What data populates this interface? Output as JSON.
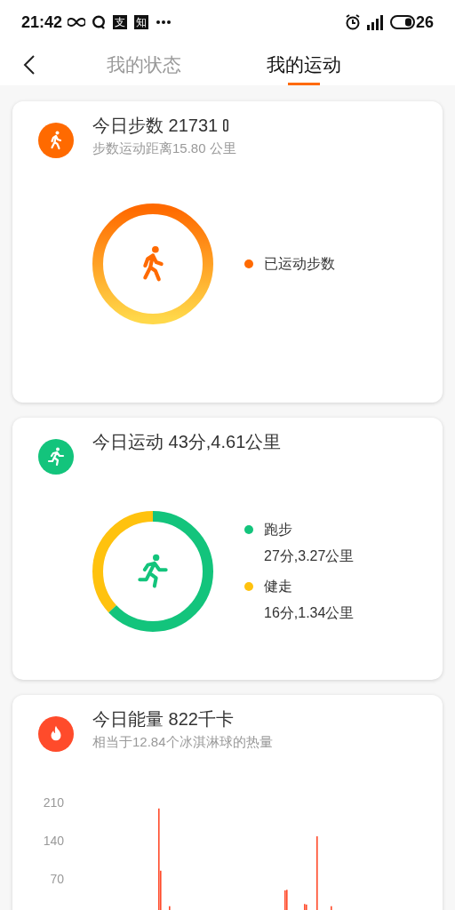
{
  "status_bar": {
    "time": "21:42",
    "app_labels": [
      "支",
      "知"
    ],
    "battery": "26"
  },
  "tabs": [
    {
      "label": "我的状态",
      "selected": false
    },
    {
      "label": "我的运动",
      "selected": true
    }
  ],
  "cards": [
    {
      "kind": "steps",
      "color": "#ff6a00",
      "title": "今日步数 21731",
      "subtitle": "步数运动距离15.80 公里",
      "legend": [
        {
          "label": "已运动步数",
          "color": "#ff6a00"
        }
      ]
    },
    {
      "kind": "activity",
      "color": "#13c47c",
      "title": "今日运动 43分,4.61公里",
      "segments": [
        {
          "label": "跑步",
          "detail": "27分,3.27公里",
          "color": "#13c47c"
        },
        {
          "label": "健走",
          "detail": "16分,1.34公里",
          "color": "#ffc20e"
        }
      ]
    },
    {
      "kind": "energy",
      "color": "#ff4b2b",
      "title": "今日能量 822千卡",
      "subtitle": "相当于12.84个冰淇淋球的热量",
      "axis_labels": [
        "210",
        "140",
        "70"
      ]
    }
  ]
}
